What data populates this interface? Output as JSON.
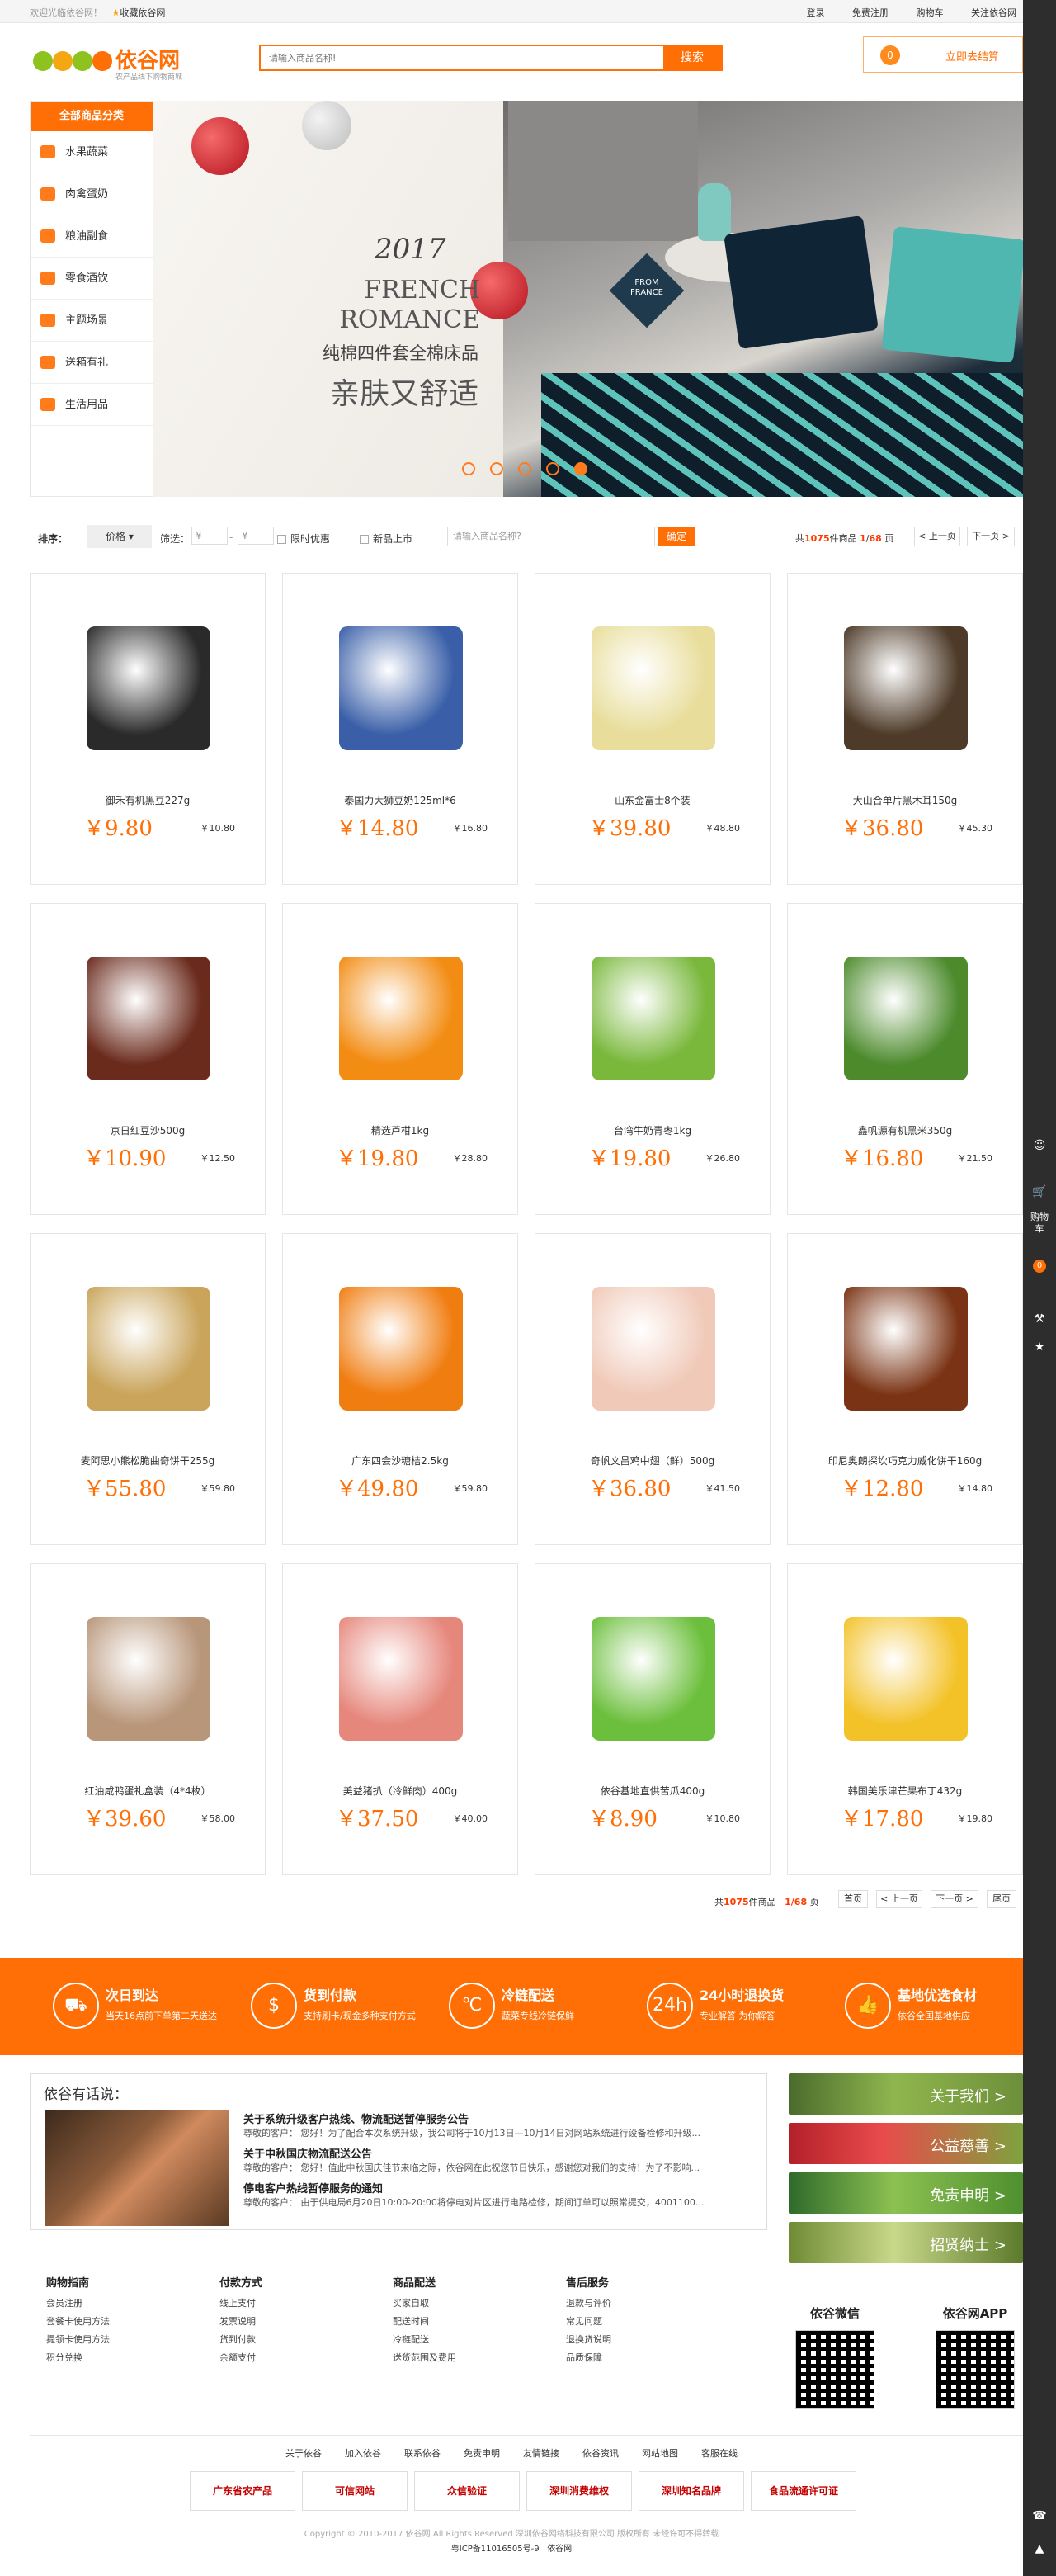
{
  "topbar": {
    "welcome": "欢迎光临依谷网！",
    "favorite": "收藏依谷网",
    "links": [
      "登录",
      "免费注册",
      "购物车",
      "关注依谷网"
    ]
  },
  "header": {
    "logo_text": "依谷网",
    "logo_sub": "农产品线下购物商城",
    "search_placeholder": "请输入商品名称!",
    "search_button": "搜索",
    "cart_count": "0",
    "cart_label": "立即去结算"
  },
  "categories": {
    "title": "全部商品分类",
    "items": [
      "水果蔬菜",
      "肉禽蛋奶",
      "粮油副食",
      "零食酒饮",
      "主题场景",
      "送箱有礼",
      "生活用品"
    ]
  },
  "banner": {
    "year": "2017",
    "line1": "FRENCH",
    "line2": "ROMANCE",
    "cn1": "纯棉四件套全棉床品",
    "cn2": "亲肤又舒适",
    "badge1": "FROM",
    "badge2": "FRANCE",
    "dots": 5,
    "active_dot": 5
  },
  "filter": {
    "sort_label": "排序：",
    "sort_value": "价格",
    "screen_label": "筛选：",
    "price_min": "¥",
    "price_max": "¥",
    "dash": "-",
    "opt1": "限时优惠",
    "opt2": "新品上市",
    "keyword_placeholder": "请输入商品名称?",
    "ok": "确定",
    "count_prefix": "共",
    "count": "1075",
    "count_suffix": "件商品",
    "page": "1",
    "pages": "68",
    "page_word": "页",
    "prev": "< 上一页",
    "next": "下一页 >"
  },
  "products": [
    {
      "name": "御禾有机黑豆227g",
      "price": "￥9.80",
      "old": "￥10.80",
      "color": "#2a2a2a"
    },
    {
      "name": "泰国力大狮豆奶125ml*6",
      "price": "￥14.80",
      "old": "￥16.80",
      "color": "#3a5fa8"
    },
    {
      "name": "山东金富士8个装",
      "price": "￥39.80",
      "old": "￥48.80",
      "color": "#e8dd9a"
    },
    {
      "name": "大山合单片黑木耳150g",
      "price": "￥36.80",
      "old": "￥45.30",
      "color": "#4d3a28"
    },
    {
      "name": "京日红豆沙500g",
      "price": "￥10.90",
      "old": "￥12.50",
      "color": "#6a2a1c"
    },
    {
      "name": "精选芦柑1kg",
      "price": "￥19.80",
      "old": "￥28.80",
      "color": "#f28c12"
    },
    {
      "name": "台湾牛奶青枣1kg",
      "price": "￥19.80",
      "old": "￥26.80",
      "color": "#7ab83c"
    },
    {
      "name": "鑫帆源有机黑米350g",
      "price": "￥16.80",
      "old": "￥21.50",
      "color": "#4c8a2c"
    },
    {
      "name": "麦阿思小熊松脆曲奇饼干255g",
      "price": "￥55.80",
      "old": "￥59.80",
      "color": "#c9a45a"
    },
    {
      "name": "广东四会沙糖桔2.5kg",
      "price": "￥49.80",
      "old": "￥59.80",
      "color": "#f07d10"
    },
    {
      "name": "奇帆文昌鸡中翅（鲜）500g",
      "price": "￥36.80",
      "old": "￥41.50",
      "color": "#f0c9b8"
    },
    {
      "name": "印尼奥朗探坎巧克力威化饼干160g",
      "price": "￥12.80",
      "old": "￥14.80",
      "color": "#7a3314"
    },
    {
      "name": "红油咸鸭蛋礼盒装（4*4枚）",
      "price": "￥39.60",
      "old": "￥58.00",
      "color": "#b8967a"
    },
    {
      "name": "美益猪扒（冷鲜肉）400g",
      "price": "￥37.50",
      "old": "￥40.00",
      "color": "#e6877c"
    },
    {
      "name": "依谷基地直供苦瓜400g",
      "price": "￥8.90",
      "old": "￥10.80",
      "color": "#6cbf3c"
    },
    {
      "name": "韩国美乐津芒果布丁432g",
      "price": "￥17.80",
      "old": "￥19.80",
      "color": "#f3c229"
    }
  ],
  "pager": {
    "prefix": "共",
    "count": "1075",
    "suffix": "件商品",
    "page": "1/68",
    "page_word": "页",
    "first": "首页",
    "prev": "< 上一页",
    "next": "下一页 >",
    "last": "尾页"
  },
  "features": [
    {
      "title": "次日到达",
      "sub": "当天16点前下单第二天送达",
      "icon": "truck-icon",
      "glyph": "⛟"
    },
    {
      "title": "货到付款",
      "sub": "支持刷卡/现金多种支付方式",
      "icon": "card-icon",
      "glyph": "$"
    },
    {
      "title": "冷链配送",
      "sub": "蔬菜专线冷链保鲜",
      "icon": "thermometer-icon",
      "glyph": "℃"
    },
    {
      "title": "24小时退换货",
      "sub": "专业解答 为你解答",
      "icon": "24h-icon",
      "glyph": "24h"
    },
    {
      "title": "基地优选食材",
      "sub": "依谷全国基地供应",
      "icon": "thumbs-up-icon",
      "glyph": "👍"
    }
  ],
  "news": {
    "title": "依谷有话说：",
    "items": [
      {
        "h": "关于系统升级客户热线、物流配送暂停服务公告",
        "t": "尊敬的客户： 您好！为了配合本次系统升级，我公司将于10月13日—10月14日对网站系统进行设备检修和升级..."
      },
      {
        "h": "关于中秋国庆物流配送公告",
        "t": "尊敬的客户： 您好！值此中秋国庆佳节来临之际，依谷网在此祝您节日快乐，感谢您对我们的支持！为了不影响..."
      },
      {
        "h": "停电客户热线暂停服务的通知",
        "t": "尊敬的客户： 由于供电局6月20日10:00-20:00将停电对片区进行电路检修，期间订单可以照常提交，4001100..."
      }
    ]
  },
  "side_links": [
    "关于我们 >",
    "公益慈善 >",
    "免责申明 >",
    "招贤纳士 >"
  ],
  "footer_cols": [
    {
      "title": "购物指南",
      "items": [
        "会员注册",
        "套餐卡使用方法",
        "提领卡使用方法",
        "积分兑换"
      ]
    },
    {
      "title": "付款方式",
      "items": [
        "线上支付",
        "发票说明",
        "货到付款",
        "余额支付"
      ]
    },
    {
      "title": "商品配送",
      "items": [
        "买家自取",
        "配送时间",
        "冷链配送",
        "送货范围及费用"
      ]
    },
    {
      "title": "售后服务",
      "items": [
        "退款与评价",
        "常见问题",
        "退换货说明",
        "品质保障"
      ]
    }
  ],
  "qr": [
    {
      "title": "依谷微信"
    },
    {
      "title": "依谷网APP"
    }
  ],
  "bottom_nav": [
    "关于依谷",
    "加入依谷",
    "联系依谷",
    "免责申明",
    "友情链接",
    "依谷资讯",
    "网站地图",
    "客服在线"
  ],
  "certs": [
    "广东省农产品",
    "可信网站",
    "众信验证",
    "深圳消费维权",
    "深圳知名品牌",
    "食品流通许可证"
  ],
  "copyright": {
    "line1": "Copyright © 2010-2017 依谷网 All Rights Reserved 深圳依谷网络科技有限公司 版权所有 未经许可不得转载",
    "icp": "粤ICP备11016505号-9",
    "brand": "依谷网"
  },
  "rightbar": {
    "cart": "购物车",
    "cart_count": "0"
  },
  "colors": {
    "accent": "#ff6f06",
    "dark": "#2d2d2d"
  }
}
